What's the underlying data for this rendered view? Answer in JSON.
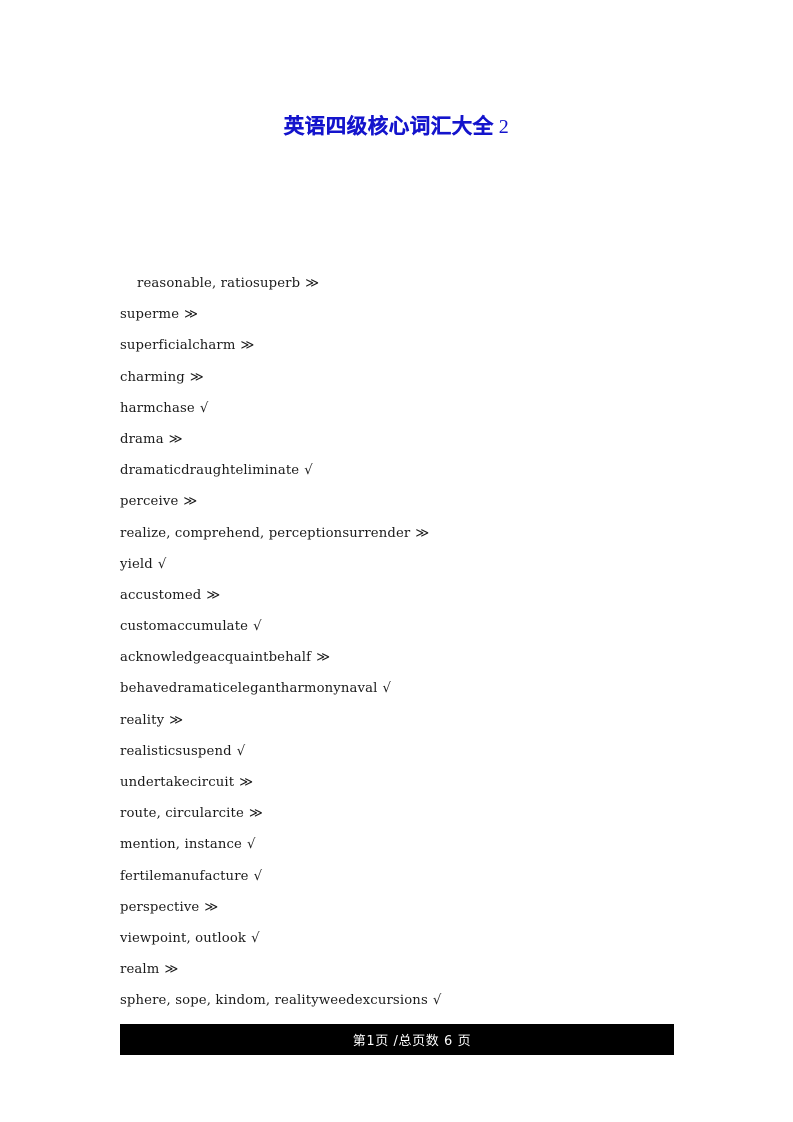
{
  "document": {
    "title_cn": "英语四级核心词汇大全",
    "title_number": "2"
  },
  "word_list": [
    {
      "text": "reasonable, ratiosuperb",
      "mark": "≫",
      "indented": true
    },
    {
      "text": "superme",
      "mark": "≫",
      "indented": false
    },
    {
      "text": "superficialcharm",
      "mark": "≫",
      "indented": false
    },
    {
      "text": "charming",
      "mark": "≫",
      "indented": false
    },
    {
      "text": "harmchase",
      "mark": "√",
      "indented": false
    },
    {
      "text": "drama",
      "mark": "≫",
      "indented": false
    },
    {
      "text": "dramaticdraughteliminate",
      "mark": "√",
      "indented": false
    },
    {
      "text": "perceive",
      "mark": "≫",
      "indented": false
    },
    {
      "text": "realize, comprehend, perceptionsurrender",
      "mark": "≫",
      "indented": false
    },
    {
      "text": "yield",
      "mark": "√",
      "indented": false
    },
    {
      "text": "accustomed",
      "mark": "≫",
      "indented": false
    },
    {
      "text": "customaccumulate",
      "mark": "√",
      "indented": false
    },
    {
      "text": "acknowledgeacquaintbehalf",
      "mark": "≫",
      "indented": false
    },
    {
      "text": "behavedramaticelegantharmonynaval",
      "mark": "√",
      "indented": false
    },
    {
      "text": "reality",
      "mark": "≫",
      "indented": false
    },
    {
      "text": "realisticsuspend",
      "mark": "√",
      "indented": false
    },
    {
      "text": "undertakecircuit",
      "mark": "≫",
      "indented": false
    },
    {
      "text": "route, circularcite",
      "mark": "≫",
      "indented": false
    },
    {
      "text": "mention, instance",
      "mark": "√",
      "indented": false
    },
    {
      "text": "fertilemanufacture",
      "mark": "√",
      "indented": false
    },
    {
      "text": "perspective",
      "mark": "≫",
      "indented": false
    },
    {
      "text": "viewpoint, outlook",
      "mark": "√",
      "indented": false
    },
    {
      "text": "realm",
      "mark": "≫",
      "indented": false
    },
    {
      "text": "sphere, sope, kindom, realityweedexcursions",
      "mark": "√",
      "indented": false
    }
  ],
  "footer": {
    "page_text": "第1页 /总页数 6 页",
    "current_page": "1",
    "total_pages": "6",
    "background_color": "#000000",
    "text_color": "#ffffff"
  },
  "colors": {
    "title_blue": "#1414CC",
    "body_text": "#1a1a1a",
    "page_background": "#ffffff"
  }
}
